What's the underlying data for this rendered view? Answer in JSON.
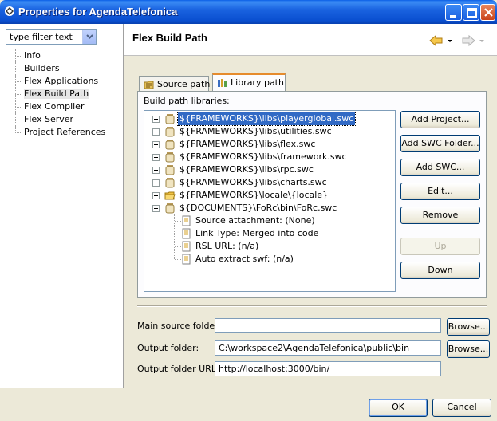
{
  "window": {
    "title": "Properties for AgendaTelefonica"
  },
  "left": {
    "filter_placeholder": "type filter text",
    "items": [
      {
        "label": "Info"
      },
      {
        "label": "Builders"
      },
      {
        "label": "Flex Applications"
      },
      {
        "label": "Flex Build Path",
        "selected": true
      },
      {
        "label": "Flex Compiler"
      },
      {
        "label": "Flex Server"
      },
      {
        "label": "Project References"
      }
    ]
  },
  "page": {
    "title": "Flex Build Path"
  },
  "tabs": [
    {
      "label": "Source path"
    },
    {
      "label": "Library path",
      "active": true
    }
  ],
  "library": {
    "section_label": "Build path libraries:",
    "entries": [
      {
        "label": "${FRAMEWORKS}\\libs\\playerglobal.swc",
        "selected": true
      },
      {
        "label": "${FRAMEWORKS}\\libs\\utilities.swc"
      },
      {
        "label": "${FRAMEWORKS}\\libs\\flex.swc"
      },
      {
        "label": "${FRAMEWORKS}\\libs\\framework.swc"
      },
      {
        "label": "${FRAMEWORKS}\\libs\\rpc.swc"
      },
      {
        "label": "${FRAMEWORKS}\\libs\\charts.swc"
      },
      {
        "label": "${FRAMEWORKS}\\locale\\{locale}"
      },
      {
        "label": "${DOCUMENTS}\\FoRc\\bin\\FoRc.swc",
        "expanded": true
      }
    ],
    "children": [
      {
        "label": "Source attachment: (None)"
      },
      {
        "label": "Link Type: Merged into code"
      },
      {
        "label": "RSL URL: (n/a)"
      },
      {
        "label": "Auto extract swf: (n/a)"
      }
    ],
    "buttons": {
      "add_project": "Add Project...",
      "add_swc_folder": "Add SWC Folder...",
      "add_swc": "Add SWC...",
      "edit": "Edit...",
      "remove": "Remove",
      "up": "Up",
      "down": "Down"
    }
  },
  "form": {
    "main_source_label": "Main source folder:",
    "main_source_value": "",
    "output_folder_label": "Output folder:",
    "output_folder_value": "C:\\workspace2\\AgendaTelefonica\\public\\bin",
    "output_url_label": "Output folder URL:",
    "output_url_value": "http://localhost:3000/bin/",
    "browse_label": "Browse..."
  },
  "footer": {
    "ok_label": "OK",
    "cancel_label": "Cancel"
  }
}
